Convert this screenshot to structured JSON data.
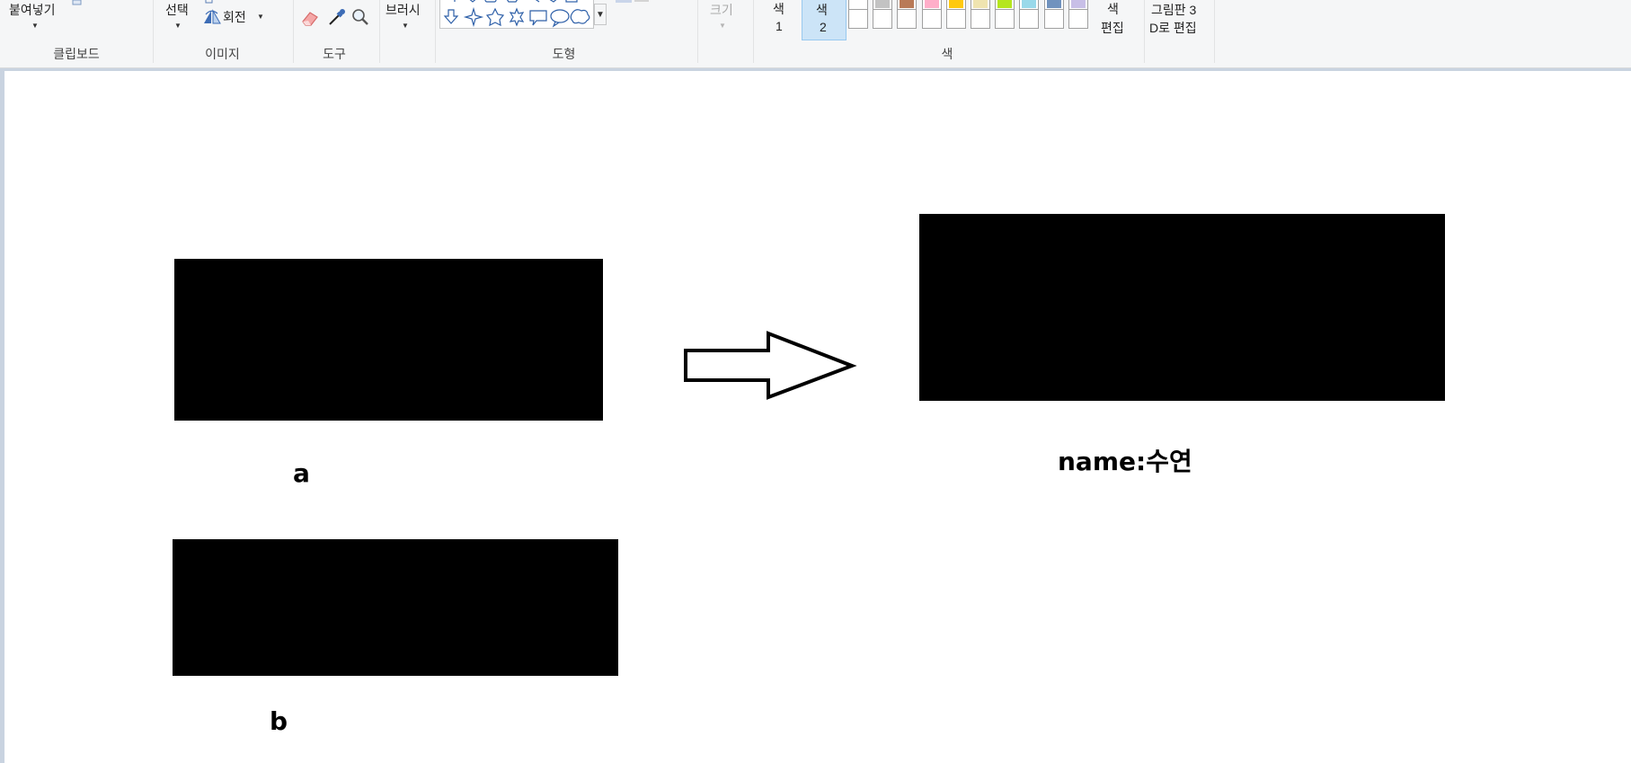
{
  "ribbon": {
    "clipboard": {
      "paste_label": "붙여넣기",
      "group_label": "클립보드"
    },
    "image": {
      "select_label": "선택",
      "rotate_label": "회전",
      "group_label": "이미지"
    },
    "tools": {
      "group_label": "도구",
      "eraser_icon": "eraser-icon",
      "picker_icon": "color-picker-icon",
      "magnifier_icon": "magnifier-icon"
    },
    "brush": {
      "label": "브러시"
    },
    "shapes": {
      "group_label": "도형"
    },
    "size": {
      "label": "크기"
    },
    "colors": {
      "color1_label_top": "색",
      "color1_label_bottom": "1",
      "color2_label_top": "색",
      "color2_label_bottom": "2",
      "edit_label_top": "색",
      "edit_label_bottom": "편집",
      "group_label": "색",
      "palette_top": [
        "#ffffff",
        "#c3c3c3",
        "#b97a57",
        "#ffaec9",
        "#ffc90e",
        "#efe4b0",
        "#b5e61d",
        "#99d9ea",
        "#7092be",
        "#c8bfe7"
      ],
      "palette_bottom": [
        "#ffffff",
        "#ffffff",
        "#ffffff",
        "#ffffff",
        "#ffffff",
        "#ffffff",
        "#ffffff",
        "#ffffff",
        "#ffffff",
        "#ffffff"
      ]
    },
    "paint3d": {
      "label_top": "그림판 3",
      "label_bottom": "D로 편집"
    }
  },
  "canvas": {
    "caption_a": "a",
    "caption_b": "b",
    "caption_name": "name:수연",
    "arrow_icon": "right-arrow-shape"
  }
}
